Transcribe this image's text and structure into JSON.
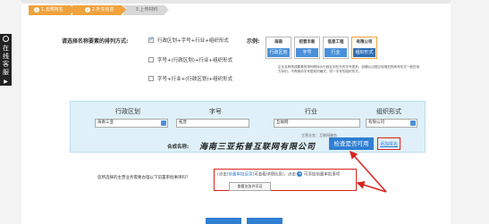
{
  "sidebar": {
    "chars": [
      "在",
      "线",
      "客",
      "服"
    ]
  },
  "steps": [
    {
      "num": "1",
      "label": "1.去附核名"
    },
    {
      "num": "2",
      "label": "2.补充信息"
    },
    {
      "num": "3",
      "label": "3.上传材料"
    }
  ],
  "question": {
    "label": "请选择名称要素的排列方式:"
  },
  "options": [
    {
      "label": "行政区划+字号+行业+组织形式",
      "checked": true
    },
    {
      "label": "字号+(行政区划)+行业+组织形式",
      "checked": false
    },
    {
      "label": "字号+行业+(行政区划)+组织形式",
      "checked": false
    }
  ],
  "example": {
    "label": "示例:",
    "cards": [
      {
        "seal": "海南",
        "tag": "行政区划"
      },
      {
        "seal": "招普丰新",
        "tag": "字号"
      },
      {
        "seal": "信息工程",
        "tag": "行业"
      },
      {
        "seal": "有限公司",
        "tag": "组织形式"
      }
    ],
    "note": "企业名称构成要素的排列顺序为行政区划在先的字号居前，如确认出现比较规范的商号形式一般在地方标识。不再使用字号居前的格式，同一字号的组织形式。"
  },
  "name_form": {
    "headers": [
      "行政区划",
      "字号",
      "行业",
      "组织形式"
    ],
    "values": [
      "海南三亚",
      "拓普",
      "互联网",
      "有限公司"
    ],
    "sub_note": "主营业务：互联网服务",
    "combo_label": "合成名称:",
    "combo_name": "海南三亚拓普互联网有限公司",
    "check_button": "检查是否可用",
    "add_link": "添加拼名"
  },
  "bottom": {
    "question": "您所选择的主营业务需要办理以下前置审批事项吗？",
    "hint_prefix": "(点击",
    "hint_link": "[前置审批目录]",
    "hint_mid": "可查看详细信息)，点击",
    "hint_plus": "+",
    "hint_suffix": "可添加前置审批事项",
    "query_button": "查看业务许可证"
  },
  "colors": {
    "accent": "#f0a23c",
    "primary": "#2f7fd3",
    "highlight": "#d9231f"
  }
}
